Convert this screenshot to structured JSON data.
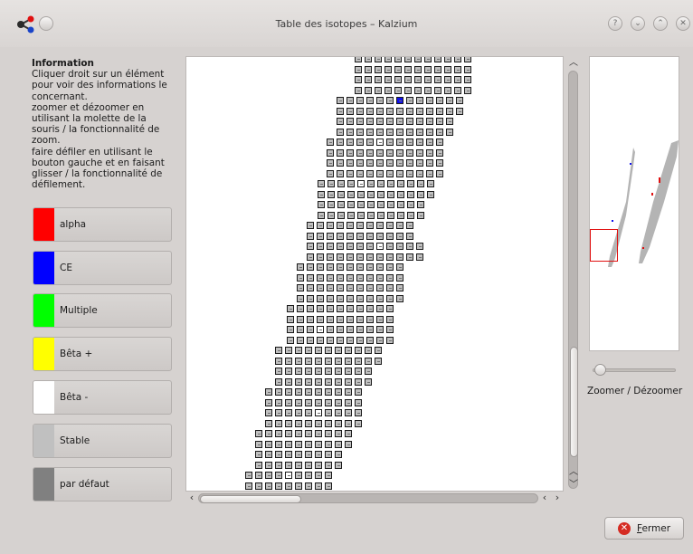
{
  "window": {
    "title": "Table des isotopes – Kalzium",
    "buttons": [
      "?",
      "⌄",
      "⌃",
      "✕"
    ]
  },
  "info": {
    "heading": "Information",
    "lines": [
      "Cliquer droit sur un élément",
      "pour voir des informations le",
      "concernant.",
      "zoomer et dézoomer en",
      "utilisant la molette de la",
      "souris / la fonctionnalité de",
      "zoom.",
      "faire défiler en utilisant le",
      "bouton gauche et en faisant",
      "glisser / la fonctionnalité de",
      "défilement."
    ]
  },
  "legend": [
    {
      "label": "alpha",
      "color": "#ff0000"
    },
    {
      "label": "CE",
      "color": "#0000ff"
    },
    {
      "label": "Multiple",
      "color": "#00ff00"
    },
    {
      "label": "Bêta +",
      "color": "#ffff00"
    },
    {
      "label": "Bêta -",
      "color": "#ffffff"
    },
    {
      "label": "Stable",
      "color": "#c0c0c0"
    },
    {
      "label": "par défaut",
      "color": "#808080"
    }
  ],
  "zoom": {
    "label": "Zoomer / Dézoomer"
  },
  "footer": {
    "close_label": "Fermer",
    "close_mnemonic": "F"
  },
  "colors": {
    "stable": "#c0c0c0",
    "beta_minus": "#ffffff",
    "ec": "#0000ff",
    "alpha": "#ff0000",
    "viewport_frame": "#e01010"
  },
  "icons": {
    "app": "kalzium-molecule-icon",
    "close": "close-circle-icon",
    "help": "help-icon"
  }
}
